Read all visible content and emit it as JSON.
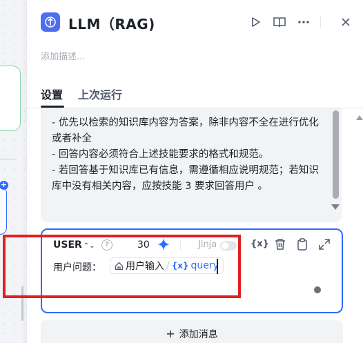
{
  "node": {
    "title": "LLM（RAG)",
    "description_placeholder": "添加描述..."
  },
  "tabs": [
    {
      "label": "设置",
      "active": true
    },
    {
      "label": "上次运行",
      "active": false
    }
  ],
  "system_prompt": {
    "lines": [
      "- 优先以检索的知识库内容为答案，除非内容不全在进行优化或者补全",
      "- 回答内容必须符合上述技能要求的格式和规范。",
      "- 若回答基于知识库已有信息，需遵循相应说明规范；若知识库中没有相关内容，应按技能 3 要求回答用户 。"
    ]
  },
  "user_message": {
    "role": "USER",
    "token_count": "30",
    "jinja_label": "Jinja",
    "jinja_enabled": false,
    "var_icon": "{x}",
    "prompt_label": "用户问题：",
    "variable": {
      "source": "用户输入",
      "separator": "/",
      "var_icon": "{x}",
      "name": "query"
    }
  },
  "add_message_label": "添加消息",
  "colors": {
    "accent": "#2f6bff",
    "highlight": "#e02020",
    "app_icon": "#4e6ef2"
  },
  "icons": {
    "app": "llm-node-icon",
    "run": "play-icon",
    "docs": "book-icon",
    "more": "more-icon",
    "close": "close-icon"
  }
}
